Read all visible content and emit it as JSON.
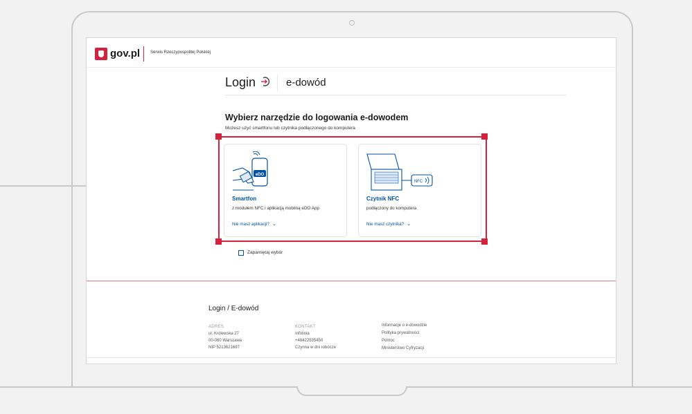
{
  "header": {
    "logo_text": "gov.pl",
    "service_name": "Serwis Rzeczypospolitej Polskiej"
  },
  "login": {
    "title": "Login",
    "subtitle": "e-dowód"
  },
  "main": {
    "heading": "Wybierz narzędzie do logowania e-dowodem",
    "subheading": "Możesz użyć smartfonu lub czytnika podłączonego do komputera"
  },
  "cards": [
    {
      "title": "Smartfon",
      "description": "z modułem NFC i aplikacją mobilną eDO App",
      "link": "Nie masz aplikacji?",
      "illustration_label": "eDO"
    },
    {
      "title": "Czytnik NFC",
      "description": "podłączony do komputera",
      "link": "Nie masz czytnika?",
      "illustration_label": "NFC"
    }
  ],
  "remember": {
    "label": "Zapamiętaj wybór",
    "checked": false
  },
  "footer": {
    "title": "Login / E-dowód",
    "address": {
      "label": "ADRES",
      "lines": [
        "ul. Królewska 27",
        "00-060 Warszawa",
        "NIP 5213621697"
      ]
    },
    "contact": {
      "label": "KONTAKT",
      "lines": [
        "Infolinia",
        "+48422535450",
        "Czynna w dni robocze"
      ]
    },
    "links": [
      "Informacje o e-dowodzie",
      "Polityka prywatności",
      "Pomoc",
      "Ministerstwo Cyfryzacji"
    ]
  },
  "colors": {
    "accent_red": "#d4213d",
    "link_blue": "#0052a5"
  }
}
